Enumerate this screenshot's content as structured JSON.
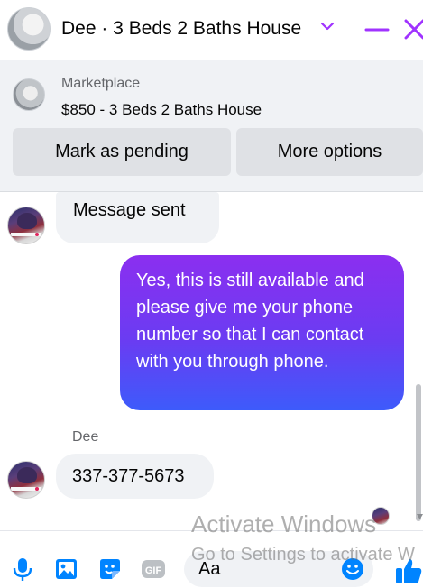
{
  "header": {
    "title": "Dee · 3 Beds 2 Baths House",
    "chevron_icon": "chevron-down-icon",
    "minimize_icon": "minimize-icon",
    "close_icon": "close-icon",
    "accent_color": "#a033ff"
  },
  "marketplace": {
    "label": "Marketplace",
    "listing": "$850 - 3 Beds 2 Baths House",
    "buttons": {
      "pending": "Mark as pending",
      "more": "More options"
    }
  },
  "thread": {
    "messages": [
      {
        "direction": "in",
        "text": "Message sent"
      },
      {
        "direction": "out",
        "text": "Yes, this is still available and please give me your phone number so that I can contact with you through phone."
      },
      {
        "direction": "in",
        "sender": "Dee",
        "text": "337-377-5673"
      }
    ]
  },
  "composer": {
    "placeholder": "Aa",
    "icons": [
      "microphone-icon",
      "photo-icon",
      "sticker-icon",
      "gif-icon",
      "emoji-icon",
      "thumbs-up-icon"
    ],
    "gif_label": "GIF",
    "icon_color": "#0084ff"
  },
  "watermark": {
    "title": "Activate Windows",
    "subtitle": "Go to Settings to activate W"
  }
}
